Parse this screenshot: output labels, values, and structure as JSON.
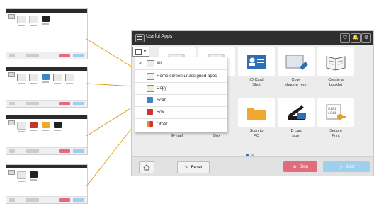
{
  "header": {
    "title": "Useful Apps",
    "icons": [
      "shield-icon",
      "bell-icon",
      "gear-icon"
    ]
  },
  "filter": {
    "button_icon": "list-icon",
    "items": [
      {
        "label": "All",
        "checked": true,
        "icon": "list-icon",
        "color": "#7a8a9a"
      },
      {
        "label": "Home screen unassigned apps",
        "checked": false,
        "icon": "home-screen-icon",
        "color": "#f2f2f2"
      },
      {
        "label": "Copy",
        "checked": false,
        "icon": "copy-icon",
        "color": "#6aa84f"
      },
      {
        "label": "Scan",
        "checked": false,
        "icon": "scan-icon",
        "color": "#3d85c6"
      },
      {
        "label": "Box",
        "checked": false,
        "icon": "box-icon",
        "color": "#cc3333"
      },
      {
        "label": "Other",
        "checked": false,
        "icon": "other-icon",
        "color": "#e69138"
      }
    ]
  },
  "apps": [
    {
      "label": "",
      "icon": "copy-app-icon"
    },
    {
      "label": "",
      "icon": "copy-app-icon"
    },
    {
      "label": "ID Card\nShot",
      "icon": "id-card-icon"
    },
    {
      "label": "Copy\nshadow rem.",
      "icon": "shadow-removal-icon"
    },
    {
      "label": "Create a\nbooklet",
      "icon": "booklet-icon"
    },
    {
      "label": "Scan to\nE-mail",
      "icon": "scan-email-icon"
    },
    {
      "label": "Scan to\nBox",
      "icon": "scan-box-icon"
    },
    {
      "label": "Scan to\nPC",
      "icon": "folder-icon"
    },
    {
      "label": "ID card\nscan",
      "icon": "id-scan-icon"
    },
    {
      "label": "Secure\nPrint",
      "icon": "secure-print-icon"
    }
  ],
  "footer": {
    "reset": "Reset",
    "stop": "Stop",
    "start": "Start"
  },
  "colors": {
    "stop": "#e06c7e",
    "start": "#9ed0ee",
    "accent": "#e0a020"
  }
}
